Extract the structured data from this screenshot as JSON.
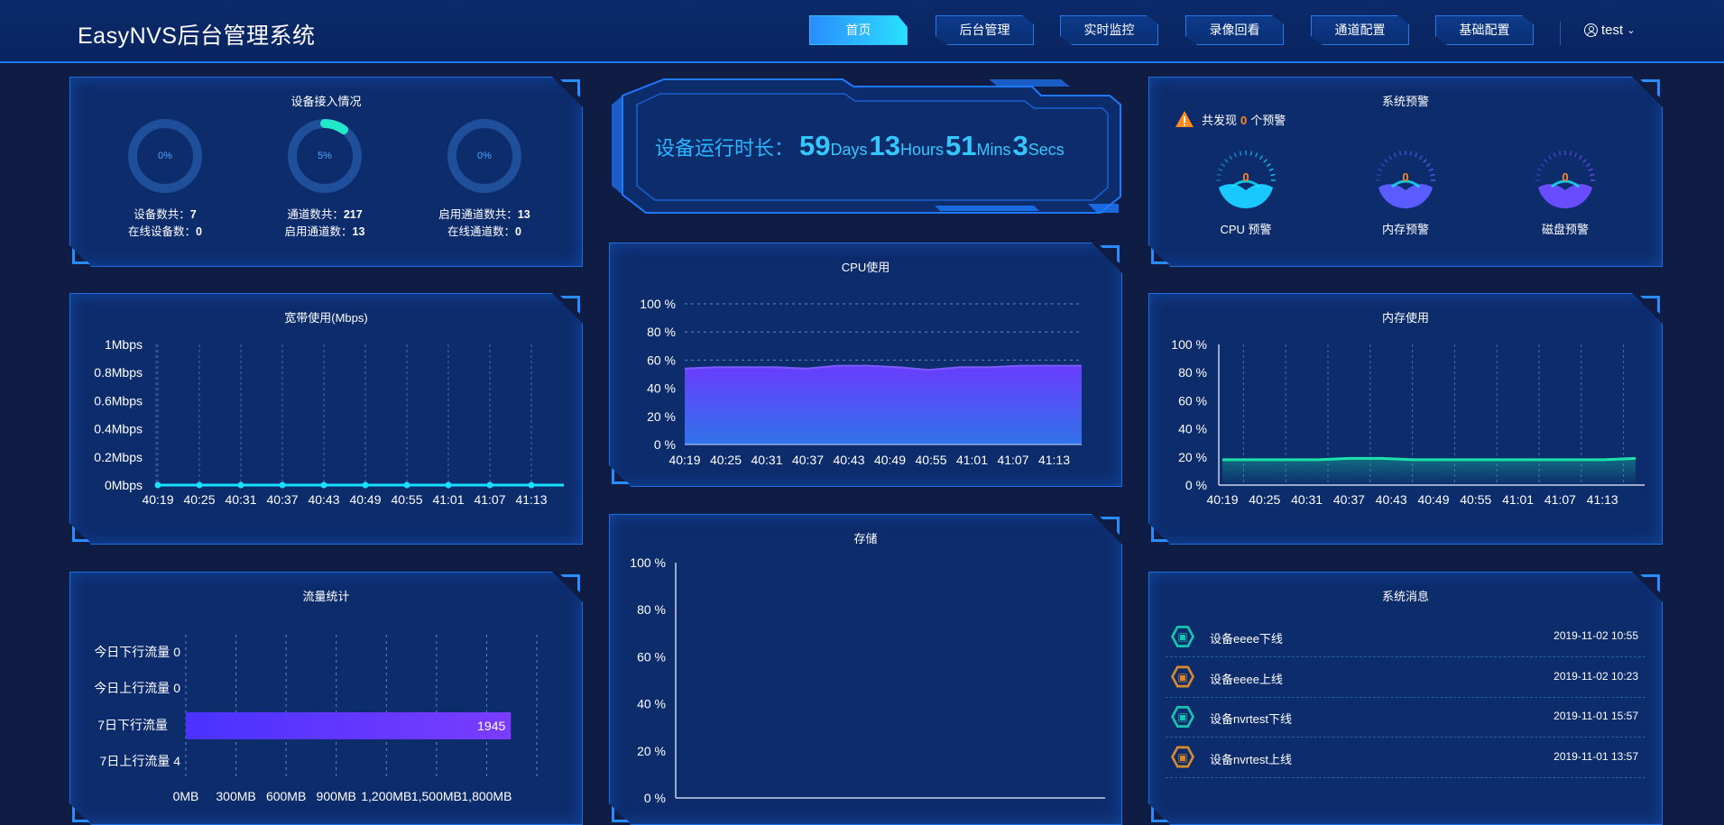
{
  "header": {
    "title": "EasyNVS后台管理系统",
    "nav": [
      {
        "label": "首页",
        "active": true
      },
      {
        "label": "后台管理",
        "active": false
      },
      {
        "label": "实时监控",
        "active": false
      },
      {
        "label": "录像回看",
        "active": false
      },
      {
        "label": "通道配置",
        "active": false
      },
      {
        "label": "基础配置",
        "active": false
      }
    ],
    "user": "test"
  },
  "device_panel": {
    "title": "设备接入情况",
    "rings": [
      {
        "percent": "0%",
        "value": 0,
        "line1_label": "设备数共：",
        "line1_value": "7",
        "line2_label": "在线设备数：",
        "line2_value": "0"
      },
      {
        "percent": "5%",
        "value": 5,
        "line1_label": "通道数共：",
        "line1_value": "217",
        "line2_label": "启用通道数：",
        "line2_value": "13"
      },
      {
        "percent": "0%",
        "value": 0,
        "line1_label": "启用通道数共：",
        "line1_value": "13",
        "line2_label": "在线通道数：",
        "line2_value": "0"
      }
    ]
  },
  "uptime": {
    "label": "设备运行时长：",
    "days": "59",
    "days_unit": "Days",
    "hours": "13",
    "hours_unit": "Hours",
    "mins": "51",
    "mins_unit": "Mins",
    "secs": "3",
    "secs_unit": "Secs"
  },
  "alerts": {
    "title": "系统预警",
    "prefix": "共发现",
    "count": "0",
    "suffix": "个预警",
    "gauges": [
      {
        "label": "CPU 预警",
        "value": "0",
        "color": "#18c8ff"
      },
      {
        "label": "内存预警",
        "value": "0",
        "color": "#5a5cff"
      },
      {
        "label": "磁盘预警",
        "value": "0",
        "color": "#6a4cff"
      }
    ]
  },
  "bandwidth": {
    "title": "宽带使用(Mbps)"
  },
  "cpu": {
    "title": "CPU使用"
  },
  "memory": {
    "title": "内存使用"
  },
  "storage": {
    "title": "存储"
  },
  "traffic": {
    "title": "流量统计"
  },
  "messages": {
    "title": "系统消息",
    "items": [
      {
        "text": "设备eeee下线",
        "time": "2019-11-02 10:55",
        "status": "offline",
        "color": "#16c6b3"
      },
      {
        "text": "设备eeee上线",
        "time": "2019-11-02 10:23",
        "status": "online",
        "color": "#d88a2c"
      },
      {
        "text": "设备nvrtest下线",
        "time": "2019-11-01 15:57",
        "status": "offline",
        "color": "#16c6b3"
      },
      {
        "text": "设备nvrtest上线",
        "time": "2019-11-01 13:57",
        "status": "online",
        "color": "#d88a2c"
      }
    ]
  },
  "chart_data": [
    {
      "id": "bandwidth",
      "type": "line",
      "title": "宽带使用(Mbps)",
      "x": [
        "40:19",
        "40:25",
        "40:31",
        "40:37",
        "40:43",
        "40:49",
        "40:55",
        "41:01",
        "41:07",
        "41:13"
      ],
      "y_ticks": [
        "0Mbps",
        "0.2Mbps",
        "0.4Mbps",
        "0.6Mbps",
        "0.8Mbps",
        "1Mbps"
      ],
      "ylim": [
        0,
        1
      ],
      "series": [
        {
          "values": [
            0,
            0,
            0,
            0,
            0,
            0,
            0,
            0,
            0,
            0
          ],
          "color": "#1ae0ff"
        }
      ]
    },
    {
      "id": "cpu",
      "type": "area",
      "title": "CPU使用",
      "x": [
        "40:19",
        "40:25",
        "40:31",
        "40:37",
        "40:43",
        "40:49",
        "40:55",
        "41:01",
        "41:07",
        "41:13"
      ],
      "y_ticks": [
        "0 %",
        "20 %",
        "40 %",
        "60 %",
        "80 %",
        "100 %"
      ],
      "ylim": [
        0,
        100
      ],
      "series": [
        {
          "values": [
            54,
            55,
            55,
            55,
            54,
            56,
            56,
            55,
            53,
            55,
            55,
            56,
            56,
            56
          ],
          "color": "#6a4cff"
        }
      ]
    },
    {
      "id": "memory",
      "type": "area",
      "title": "内存使用",
      "x": [
        "40:19",
        "40:25",
        "40:31",
        "40:37",
        "40:43",
        "40:49",
        "40:55",
        "41:01",
        "41:07",
        "41:13"
      ],
      "y_ticks": [
        "0 %",
        "20 %",
        "40 %",
        "60 %",
        "80 %",
        "100 %"
      ],
      "ylim": [
        0,
        100
      ],
      "series": [
        {
          "values": [
            18,
            18,
            18,
            18,
            19,
            19,
            18,
            18,
            18,
            18,
            18,
            18,
            18,
            19
          ],
          "color": "#19e3a8"
        }
      ]
    },
    {
      "id": "storage",
      "type": "bar",
      "title": "存储",
      "categories": [],
      "y_ticks": [
        "0 %",
        "20 %",
        "40 %",
        "60 %",
        "80 %",
        "100 %"
      ],
      "ylim": [
        0,
        100
      ],
      "values": []
    },
    {
      "id": "traffic",
      "type": "bar",
      "orientation": "horizontal",
      "title": "流量统计",
      "categories": [
        "今日下行流量",
        "今日上行流量",
        "7日下行流量",
        "7日上行流量"
      ],
      "values": [
        0,
        0,
        1945,
        4
      ],
      "value_labels": [
        "0",
        "0",
        "1945",
        "4"
      ],
      "x_ticks": [
        "0MB",
        "300MB",
        "600MB",
        "900MB",
        "1,200MB",
        "1,500MB",
        "1,800MB"
      ],
      "xlim": [
        0,
        2100
      ],
      "color": "#6a3cff"
    }
  ]
}
